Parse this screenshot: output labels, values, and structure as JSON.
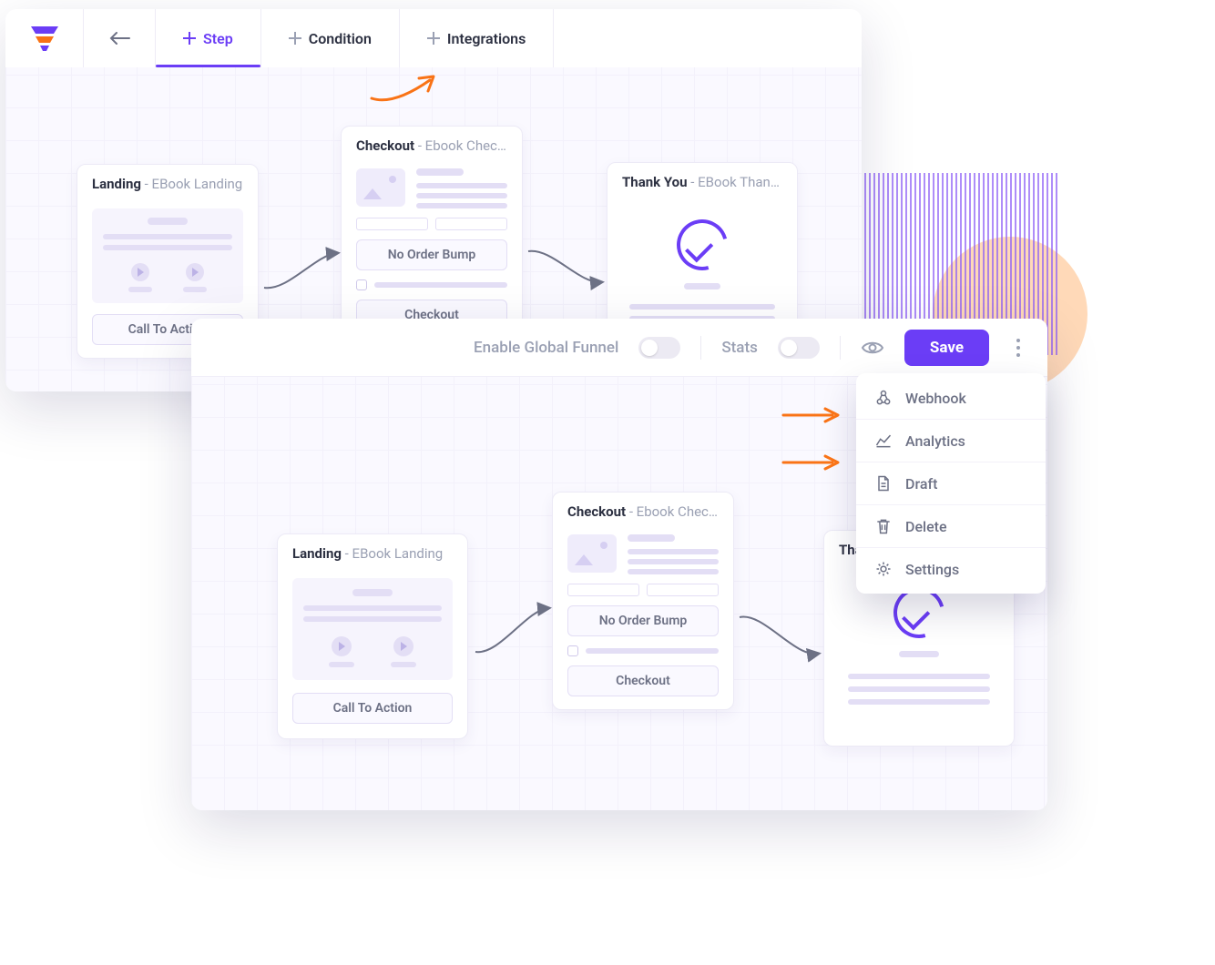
{
  "colors": {
    "accent": "#6b3df6",
    "orange": "#f97316",
    "muted": "#9aa0b3"
  },
  "toolbar": {
    "tabs": [
      {
        "label": "Step",
        "active": true
      },
      {
        "label": "Condition",
        "active": false
      },
      {
        "label": "Integrations",
        "active": false
      }
    ]
  },
  "header": {
    "enable_label": "Enable Global Funnel",
    "enable_on": false,
    "stats_label": "Stats",
    "stats_on": false,
    "save_label": "Save"
  },
  "menu": {
    "items": [
      {
        "icon": "webhook-icon",
        "label": "Webhook"
      },
      {
        "icon": "analytics-icon",
        "label": "Analytics"
      },
      {
        "icon": "draft-icon",
        "label": "Draft"
      },
      {
        "icon": "delete-icon",
        "label": "Delete"
      },
      {
        "icon": "settings-icon",
        "label": "Settings"
      }
    ]
  },
  "cards": {
    "landing": {
      "title": "Landing",
      "subtitle": " - EBook Landing",
      "cta": "Call To Action"
    },
    "checkout": {
      "title": "Checkout",
      "subtitle": " - Ebook Checkout",
      "bump": "No Order Bump",
      "btn": "Checkout"
    },
    "thankyou": {
      "title": "Thank You",
      "subtitle": " - EBook Thank Y…"
    },
    "thankyou_short": "Tha"
  }
}
